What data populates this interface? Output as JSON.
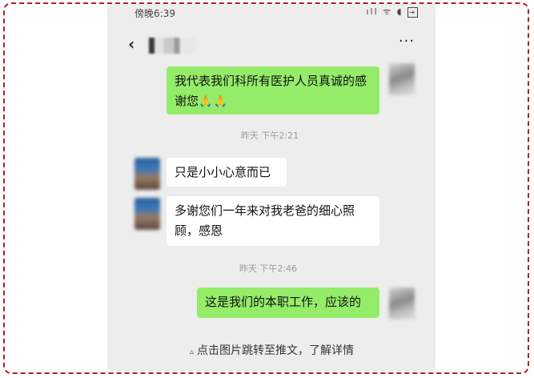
{
  "status_bar": {
    "time": "傍晚6:39",
    "icons": "ıll ᯤ ◖",
    "exit_icon_label": "⇥"
  },
  "header": {
    "back_icon": "‹",
    "more_icon": "···"
  },
  "messages": [
    {
      "sender": "me",
      "text": "我代表我们科所有医护人员真诚的感谢您",
      "emoji": "🙏🙏"
    },
    {
      "sender": "them",
      "text": "只是小小心意而已"
    },
    {
      "sender": "them",
      "text": "多谢您们一年来对我老爸的细心照顾，感恩"
    },
    {
      "sender": "me",
      "text": "这是我们的本职工作，应该的"
    }
  ],
  "timestamps": [
    "昨天 下午2:21",
    "昨天 下午2:46"
  ],
  "caption": {
    "icon": "▵",
    "text": "点击图片跳转至推文，了解详情"
  },
  "colors": {
    "frame_border": "#b41e2a",
    "chat_background": "#ededed",
    "my_bubble": "#95ec69",
    "their_bubble": "#ffffff"
  }
}
